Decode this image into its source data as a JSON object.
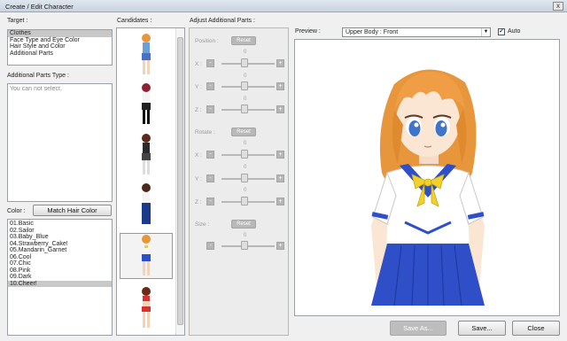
{
  "window": {
    "title": "Create / Edit Character",
    "close_glyph": "x"
  },
  "target": {
    "label": "Target :",
    "items": [
      "Clothes",
      "Face Type and Eye Color",
      "Hair Style and Color",
      "Additional Parts"
    ],
    "selected_index": 0
  },
  "additional_parts": {
    "label": "Additional Parts Type :",
    "message": "You can not select."
  },
  "color": {
    "label": "Color :",
    "match_button": "Match Hair Color",
    "items": [
      "01.Basic",
      "02.Sailor",
      "03.Baby_Blue",
      "04.Strawberry_Cake!",
      "05.Mandarin_Garnet",
      "06.Cool",
      "07.Chic",
      "08.Pink",
      "09.Dark",
      "10.Cheer!"
    ],
    "selected_index": 9
  },
  "candidates": {
    "label": "Candidates :",
    "selected_index": 4
  },
  "adjust": {
    "label": "Adjust Additional Parts :",
    "position_label": "Position :",
    "rotate_label": "Rotate :",
    "size_label": "Size :",
    "reset": "Reset",
    "axes": [
      "X :",
      "Y :",
      "Z :"
    ],
    "zero": "0",
    "minus": "-",
    "plus": "+"
  },
  "preview": {
    "label": "Preview :",
    "view": "Upper Body : Front",
    "auto_label": "Auto",
    "auto_checked": "✓"
  },
  "buttons": {
    "save_as": "Save As...",
    "save": "Save...",
    "close": "Close"
  },
  "colors": {
    "hair": "#e8963c",
    "skirt": "#2f4fc8",
    "shirt": "#ffffff",
    "ribbon": "#f2d12a",
    "eyes": "#3f74c9"
  }
}
